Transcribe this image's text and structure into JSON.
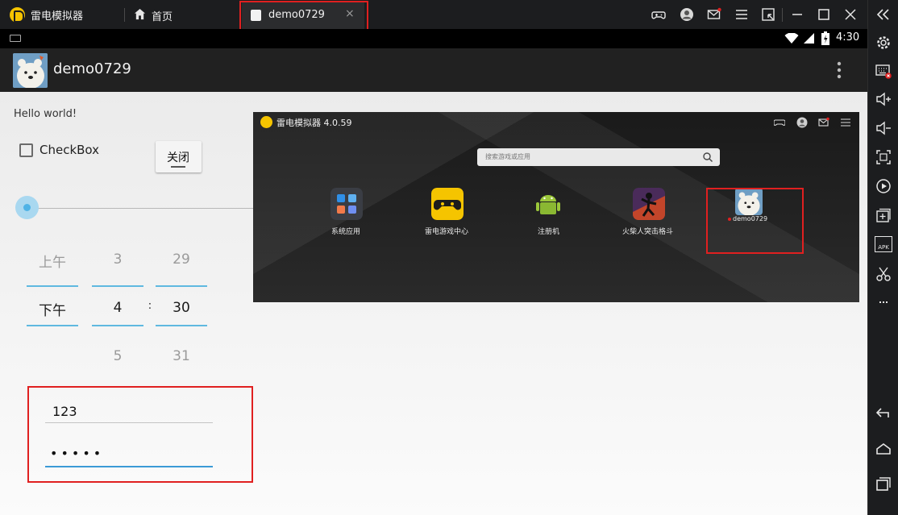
{
  "titlebar": {
    "app_name": "雷电模拟器",
    "home_tab_label": "首页",
    "active_tab_label": "demo0729",
    "tab_close_glyph": "×",
    "icons": [
      "gamepad-icon",
      "account-icon",
      "mail-icon",
      "menu-icon",
      "shrink-icon",
      "minimize-icon",
      "maximize-icon",
      "close-icon"
    ]
  },
  "sidebar": {
    "icons": [
      "collapse-icon",
      "settings-icon",
      "keymap-icon",
      "volume-up-icon",
      "volume-down-icon",
      "fullscreen-icon",
      "record-icon",
      "add-window-icon",
      "apk-icon",
      "scissors-icon",
      "back-icon",
      "home-icon",
      "recents-icon"
    ],
    "apk_label": "APK"
  },
  "statusbar": {
    "time": "4:30"
  },
  "actionbar": {
    "title": "demo0729"
  },
  "form": {
    "hello_text": "Hello world!",
    "checkbox_label": "CheckBox",
    "checkbox_checked": false,
    "close_button_label": "关闭",
    "seekbar_value": 0,
    "time_picker": {
      "ampm": {
        "prev": "上午",
        "selected": "下午",
        "next": ""
      },
      "hour": {
        "prev": "3",
        "selected": "4",
        "next": "5"
      },
      "separator": ":",
      "minute": {
        "prev": "29",
        "selected": "30",
        "next": "31"
      }
    },
    "username_value": "123",
    "password_value": "•••••"
  },
  "launcher": {
    "title": "雷电模拟器 4.0.59",
    "search_placeholder": "搜索游戏或应用",
    "apps": [
      {
        "label": "系统应用",
        "icon": "system-apps-icon"
      },
      {
        "label": "雷电游戏中心",
        "icon": "game-center-icon"
      },
      {
        "label": "注册机",
        "icon": "android-icon"
      },
      {
        "label": "火柴人突击格斗",
        "icon": "stickman-game-icon"
      },
      {
        "label": "demo0729",
        "icon": "polar-bear-icon"
      }
    ]
  },
  "colors": {
    "highlight": "#e02020",
    "accent": "#5fb9e0",
    "brand_yellow": "#f5c400"
  }
}
